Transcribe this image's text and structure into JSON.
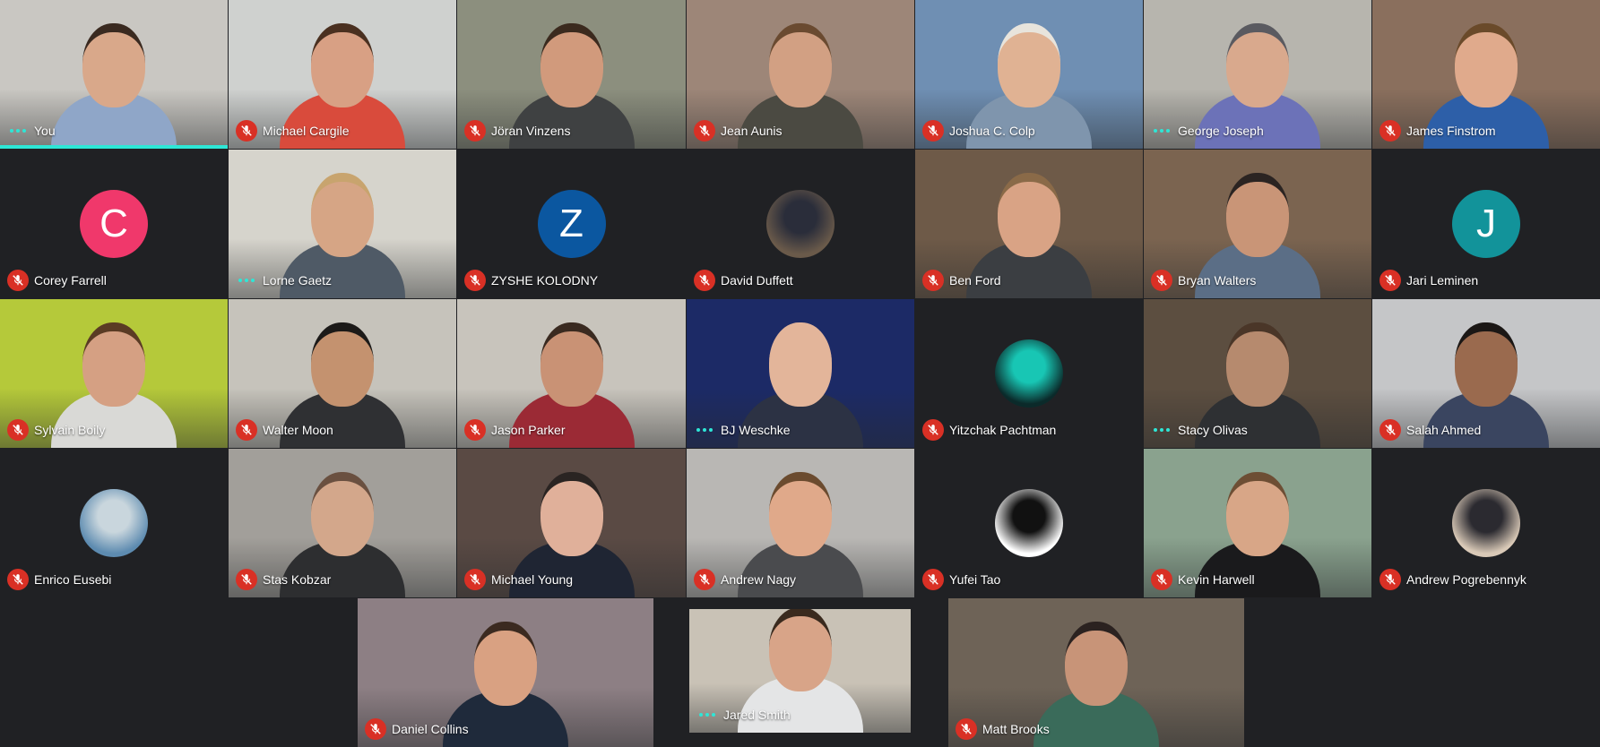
{
  "colors": {
    "background": "#202124",
    "muted_mic": "#d93025",
    "speaking_indicator": "#2ee6d6"
  },
  "participants": [
    {
      "name": "You",
      "status": "speaking",
      "tile": "video",
      "bg": "#c9c7c2",
      "shirt": "#8fa6c8",
      "skin": "#d9a88a",
      "hair": "#3a2a20",
      "highlight": true
    },
    {
      "name": "Michael Cargile",
      "status": "muted",
      "tile": "video",
      "bg": "#cfd1cf",
      "shirt": "#d94b3c",
      "skin": "#d8a084",
      "hair": "#4a3020"
    },
    {
      "name": "Jöran Vinzens",
      "status": "muted",
      "tile": "video",
      "bg": "#8c8f7e",
      "shirt": "#3f4142",
      "skin": "#d19a7c",
      "hair": "#3b2a1e"
    },
    {
      "name": "Jean Aunis",
      "status": "muted",
      "tile": "video",
      "bg": "#9d8678",
      "shirt": "#4b4a42",
      "skin": "#d2a083",
      "hair": "#6a4a30"
    },
    {
      "name": "Joshua C. Colp",
      "status": "muted",
      "tile": "video",
      "bg": "#6f8fb3",
      "shirt": "#7f95ad",
      "skin": "#e0b293",
      "hair": "#e8e4dc"
    },
    {
      "name": "George Joseph",
      "status": "speaking",
      "tile": "video",
      "bg": "#b7b5ae",
      "shirt": "#6c72b8",
      "skin": "#d9a98d",
      "hair": "#5a5a60"
    },
    {
      "name": "James Finstrom",
      "status": "muted",
      "tile": "video",
      "bg": "#8a6f5d",
      "shirt": "#2d5fa8",
      "skin": "#e0aa8c",
      "hair": "#6a4a2a"
    },
    {
      "name": "Corey Farrell",
      "status": "muted",
      "tile": "avatar",
      "letter": "C",
      "avatar_color": "#f0386b"
    },
    {
      "name": "Lorne Gaetz",
      "status": "speaking",
      "tile": "video",
      "bg": "#d6d4cc",
      "shirt": "#4f5a66",
      "skin": "#d6a585",
      "hair": "#c8a46e"
    },
    {
      "name": "ZYSHE KOLODNY",
      "status": "muted",
      "tile": "avatar",
      "letter": "Z",
      "avatar_color": "#0b57a0"
    },
    {
      "name": "David Duffett",
      "status": "muted",
      "tile": "photo",
      "photo_bg": "#6a5a4a",
      "photo_fg": "#2a2d3a"
    },
    {
      "name": "Ben Ford",
      "status": "muted",
      "tile": "video",
      "bg": "#6e5a48",
      "shirt": "#3b3e42",
      "skin": "#d9a385",
      "hair": "#8a6a48"
    },
    {
      "name": "Bryan Walters",
      "status": "muted",
      "tile": "video",
      "bg": "#7b6450",
      "shirt": "#5b6e86",
      "skin": "#c99577",
      "hair": "#2b2422"
    },
    {
      "name": "Jari Leminen",
      "status": "muted",
      "tile": "avatar",
      "letter": "J",
      "avatar_color": "#12939a"
    },
    {
      "name": "Sylvain Boily",
      "status": "muted",
      "tile": "video",
      "bg": "#b5c93a",
      "shirt": "#d9d9d6",
      "skin": "#d5a083",
      "hair": "#5a3b24"
    },
    {
      "name": "Walter Moon",
      "status": "muted",
      "tile": "video",
      "bg": "#c6c3bb",
      "shirt": "#2f3033",
      "skin": "#c4926f",
      "hair": "#1c1a18"
    },
    {
      "name": "Jason Parker",
      "status": "muted",
      "tile": "video",
      "bg": "#c8c4bc",
      "shirt": "#9b2a35",
      "skin": "#c99275",
      "hair": "#3a2a20"
    },
    {
      "name": "BJ Weschke",
      "status": "speaking",
      "tile": "video",
      "bg": "#1c2a66",
      "shirt": "#2c3244",
      "skin": "#e3b59a",
      "hair": "#e3b59a"
    },
    {
      "name": "Yitzchak Pachtman",
      "status": "muted",
      "tile": "photo",
      "photo_bg": "#0b2a2a",
      "photo_fg": "#18c6b4"
    },
    {
      "name": "Stacy Olivas",
      "status": "speaking",
      "tile": "video",
      "bg": "#5c4e40",
      "shirt": "#2e3033",
      "skin": "#b68a6e",
      "hair": "#4a3628"
    },
    {
      "name": "Salah Ahmed",
      "status": "muted",
      "tile": "video",
      "bg": "#c5c6c8",
      "shirt": "#3a4560",
      "skin": "#9a6a4e",
      "hair": "#1b1715"
    },
    {
      "name": "Enrico Eusebi",
      "status": "muted",
      "tile": "photo",
      "photo_bg": "#5d8bb0",
      "photo_fg": "#c9d6dd"
    },
    {
      "name": "Stas Kobzar",
      "status": "muted",
      "tile": "video",
      "bg": "#a29f9a",
      "shirt": "#2d2e30",
      "skin": "#d3a78b",
      "hair": "#6a5040"
    },
    {
      "name": "Michael Young",
      "status": "muted",
      "tile": "video",
      "bg": "#5a4a44",
      "shirt": "#1f2533",
      "skin": "#e0b09a",
      "hair": "#2a2422"
    },
    {
      "name": "Andrew Nagy",
      "status": "muted",
      "tile": "video",
      "bg": "#b9b7b4",
      "shirt": "#4a4b4e",
      "skin": "#e0a98a",
      "hair": "#6b4b2f"
    },
    {
      "name": "Yufei Tao",
      "status": "muted",
      "tile": "photo",
      "photo_bg": "#ffffff",
      "photo_fg": "#111111"
    },
    {
      "name": "Kevin Harwell",
      "status": "muted",
      "tile": "video",
      "bg": "#8aa28e",
      "shirt": "#1a1a1c",
      "skin": "#d8a687",
      "hair": "#6d4e34"
    },
    {
      "name": "Andrew Pogrebennyk",
      "status": "muted",
      "tile": "photo",
      "photo_bg": "#d9c9b7",
      "photo_fg": "#2b2a30"
    },
    {
      "name": "Daniel Collins",
      "status": "muted",
      "tile": "video",
      "bg": "#8d7f84",
      "shirt": "#1f2a3b",
      "skin": "#d9a182",
      "hair": "#3b2a20"
    },
    {
      "name": "Jared Smith",
      "status": "speaking",
      "tile": "video",
      "bg": "#c9c2b6",
      "shirt": "#e4e5e6",
      "skin": "#d8a488",
      "hair": "#3a2a1e"
    },
    {
      "name": "Matt Brooks",
      "status": "muted",
      "tile": "video",
      "bg": "#6e6357",
      "shirt": "#3a6b5a",
      "skin": "#c89478",
      "hair": "#2b2220"
    }
  ]
}
